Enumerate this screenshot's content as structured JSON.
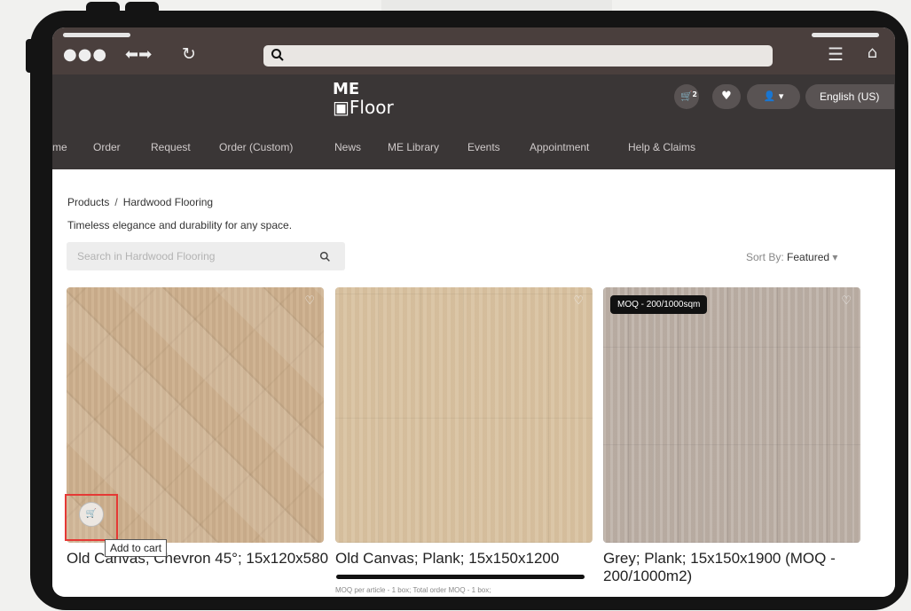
{
  "browser": {
    "address_value": "",
    "icons": [
      "dots-icon",
      "back-forward-icon",
      "reload-icon",
      "search-icon",
      "menu-icon",
      "home-icon"
    ]
  },
  "header": {
    "logo_line1": "ME",
    "logo_line2": "Floor",
    "cart_count": "2",
    "language": "English (US)"
  },
  "nav": {
    "items": [
      "me",
      "Order",
      "Request",
      "Order (Custom)",
      "News",
      "ME Library",
      "Events",
      "Appointment",
      "Help & Claims"
    ]
  },
  "page": {
    "breadcrumb_root": "Products",
    "breadcrumb_current": "Hardwood Flooring",
    "tagline": "Timeless elegance and durability for any space.",
    "search_placeholder": "Search in Hardwood Flooring",
    "sort_label": "Sort By:",
    "sort_value": "Featured"
  },
  "products": [
    {
      "title": "Old Canvas; Chevron 45°; 15x120x580",
      "subtitle": "",
      "badge": ""
    },
    {
      "title": "Old Canvas; Plank; 15x150x1200",
      "subtitle": "MOQ per article - 1 box; Total order MOQ - 1 box;",
      "badge": ""
    },
    {
      "title": "Grey; Plank; 15x150x1900 (MOQ - 200/1000m2)",
      "subtitle": "",
      "badge": "MOQ - 200/1000sqm"
    }
  ],
  "tooltip": {
    "text": "Add to cart"
  },
  "colors": {
    "header_bg": "#3a3636",
    "chrome_bg": "#4a3f3d",
    "highlight": "#e53935"
  }
}
